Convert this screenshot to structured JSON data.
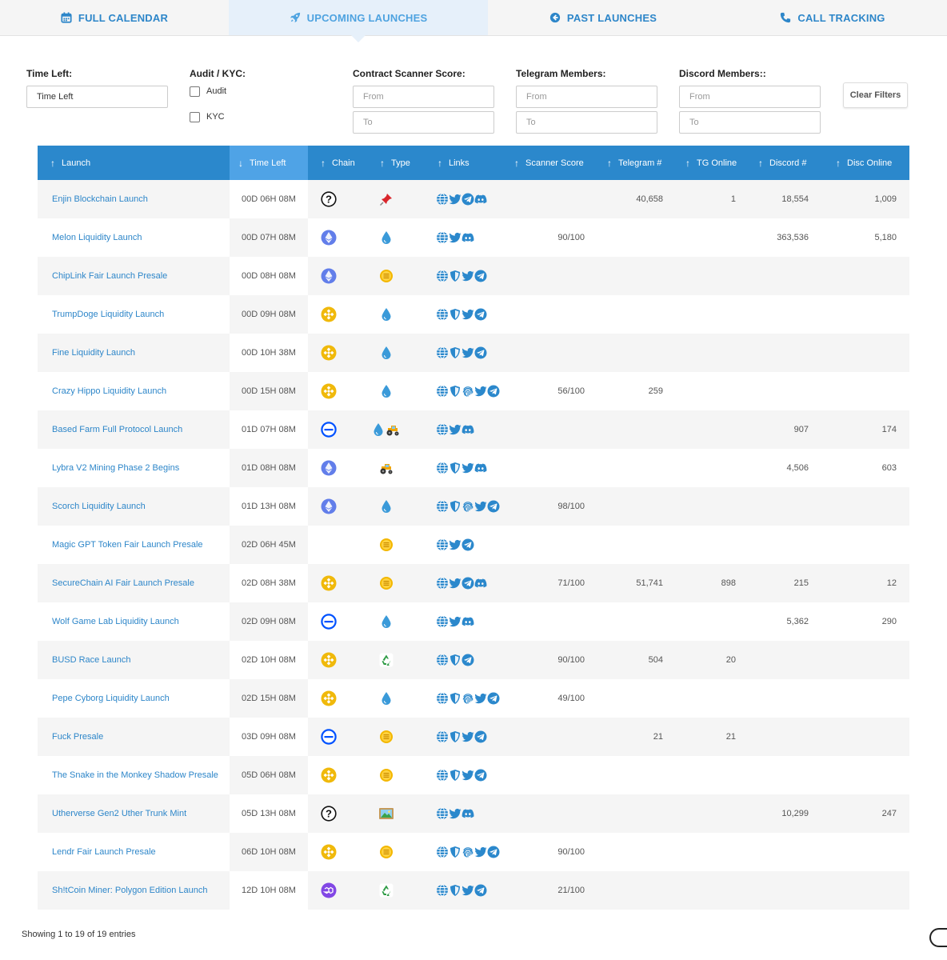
{
  "tabs": [
    {
      "label": "FULL CALENDAR",
      "icon": "calendar-icon"
    },
    {
      "label": "UPCOMING LAUNCHES",
      "icon": "rocket-icon",
      "active": true
    },
    {
      "label": "PAST LAUNCHES",
      "icon": "arrow-left-circle-icon"
    },
    {
      "label": "CALL TRACKING",
      "icon": "phone-icon"
    }
  ],
  "filters": {
    "time_left": {
      "label": "Time Left:",
      "value": "Time Left"
    },
    "audit_kyc": {
      "label": "Audit / KYC:",
      "audit": "Audit",
      "kyc": "KYC"
    },
    "scanner": {
      "label": "Contract Scanner Score:",
      "from": "From",
      "to": "To"
    },
    "telegram": {
      "label": "Telegram Members:",
      "from": "From",
      "to": "To"
    },
    "discord": {
      "label": "Discord Members::",
      "from": "From",
      "to": "To"
    },
    "clear": "Clear Filters"
  },
  "columns": [
    "Launch",
    "Time Left",
    "Chain",
    "Type",
    "Links",
    "Scanner Score",
    "Telegram #",
    "TG Online",
    "Discord #",
    "Disc Online"
  ],
  "rows": [
    {
      "launch": "Enjin Blockchain Launch",
      "time": "00D 06H 08M",
      "chain": "unknown",
      "type": [
        "pin"
      ],
      "links": [
        "web",
        "twitter",
        "telegram",
        "discord"
      ],
      "score": "",
      "tg": "40,658",
      "tgo": "1",
      "dc": "18,554",
      "dco": "1,009"
    },
    {
      "launch": "Melon Liquidity Launch",
      "time": "00D 07H 08M",
      "chain": "eth",
      "type": [
        "drop"
      ],
      "links": [
        "web",
        "twitter",
        "discord"
      ],
      "score": "90/100",
      "tg": "",
      "tgo": "",
      "dc": "363,536",
      "dco": "5,180"
    },
    {
      "launch": "ChipLink Fair Launch Presale",
      "time": "00D 08H 08M",
      "chain": "eth",
      "type": [
        "coin"
      ],
      "links": [
        "web",
        "shield",
        "twitter",
        "telegram"
      ],
      "score": "",
      "tg": "",
      "tgo": "",
      "dc": "",
      "dco": ""
    },
    {
      "launch": "TrumpDoge Liquidity Launch",
      "time": "00D 09H 08M",
      "chain": "bsc",
      "type": [
        "drop"
      ],
      "links": [
        "web",
        "shield",
        "twitter",
        "telegram"
      ],
      "score": "",
      "tg": "",
      "tgo": "",
      "dc": "",
      "dco": ""
    },
    {
      "launch": "Fine Liquidity Launch",
      "time": "00D 10H 38M",
      "chain": "bsc",
      "type": [
        "drop"
      ],
      "links": [
        "web",
        "shield",
        "twitter",
        "telegram"
      ],
      "score": "",
      "tg": "",
      "tgo": "",
      "dc": "",
      "dco": ""
    },
    {
      "launch": "Crazy Hippo Liquidity Launch",
      "time": "00D 15H 08M",
      "chain": "bsc",
      "type": [
        "drop"
      ],
      "links": [
        "web",
        "shield",
        "fingerprint",
        "twitter",
        "telegram"
      ],
      "score": "56/100",
      "tg": "259",
      "tgo": "",
      "dc": "",
      "dco": ""
    },
    {
      "launch": "Based Farm Full Protocol Launch",
      "time": "01D 07H 08M",
      "chain": "base",
      "type": [
        "drop",
        "tractor"
      ],
      "links": [
        "web",
        "twitter",
        "discord"
      ],
      "score": "",
      "tg": "",
      "tgo": "",
      "dc": "907",
      "dco": "174"
    },
    {
      "launch": "Lybra V2 Mining Phase 2 Begins",
      "time": "01D 08H 08M",
      "chain": "eth",
      "type": [
        "tractor"
      ],
      "links": [
        "web",
        "shield",
        "twitter",
        "discord"
      ],
      "score": "",
      "tg": "",
      "tgo": "",
      "dc": "4,506",
      "dco": "603"
    },
    {
      "launch": "Scorch Liquidity Launch",
      "time": "01D 13H 08M",
      "chain": "eth",
      "type": [
        "drop"
      ],
      "links": [
        "web",
        "shield",
        "fingerprint",
        "twitter",
        "telegram"
      ],
      "score": "98/100",
      "tg": "",
      "tgo": "",
      "dc": "",
      "dco": ""
    },
    {
      "launch": "Magic GPT Token Fair Launch Presale",
      "time": "02D 06H 45M",
      "chain": "none",
      "type": [
        "coin"
      ],
      "links": [
        "web",
        "twitter",
        "telegram"
      ],
      "score": "",
      "tg": "",
      "tgo": "",
      "dc": "",
      "dco": ""
    },
    {
      "launch": "SecureChain AI Fair Launch Presale",
      "time": "02D 08H 38M",
      "chain": "bsc",
      "type": [
        "coin"
      ],
      "links": [
        "web",
        "twitter",
        "telegram",
        "discord"
      ],
      "score": "71/100",
      "tg": "51,741",
      "tgo": "898",
      "dc": "215",
      "dco": "12"
    },
    {
      "launch": "Wolf Game Lab Liquidity Launch",
      "time": "02D 09H 08M",
      "chain": "base",
      "type": [
        "drop"
      ],
      "links": [
        "web",
        "twitter",
        "discord"
      ],
      "score": "",
      "tg": "",
      "tgo": "",
      "dc": "5,362",
      "dco": "290"
    },
    {
      "launch": "BUSD Race Launch",
      "time": "02D 10H 08M",
      "chain": "bsc",
      "type": [
        "recycle"
      ],
      "links": [
        "web",
        "shield",
        "telegram"
      ],
      "score": "90/100",
      "tg": "504",
      "tgo": "20",
      "dc": "",
      "dco": ""
    },
    {
      "launch": "Pepe Cyborg Liquidity Launch",
      "time": "02D 15H 08M",
      "chain": "bsc",
      "type": [
        "drop"
      ],
      "links": [
        "web",
        "shield",
        "fingerprint",
        "twitter",
        "telegram"
      ],
      "score": "49/100",
      "tg": "",
      "tgo": "",
      "dc": "",
      "dco": ""
    },
    {
      "launch": "Fuck Presale",
      "time": "03D 09H 08M",
      "chain": "base",
      "type": [
        "coin"
      ],
      "links": [
        "web",
        "shield",
        "twitter",
        "telegram"
      ],
      "score": "",
      "tg": "21",
      "tgo": "21",
      "dc": "",
      "dco": ""
    },
    {
      "launch": "The Snake in the Monkey Shadow Presale",
      "time": "05D 06H 08M",
      "chain": "bsc",
      "type": [
        "coin"
      ],
      "links": [
        "web",
        "shield",
        "twitter",
        "telegram"
      ],
      "score": "",
      "tg": "",
      "tgo": "",
      "dc": "",
      "dco": ""
    },
    {
      "launch": "Utherverse Gen2 Uther Trunk Mint",
      "time": "05D 13H 08M",
      "chain": "unknown",
      "type": [
        "picture"
      ],
      "links": [
        "web",
        "twitter",
        "discord"
      ],
      "score": "",
      "tg": "",
      "tgo": "",
      "dc": "10,299",
      "dco": "247"
    },
    {
      "launch": "Lendr Fair Launch Presale",
      "time": "06D 10H 08M",
      "chain": "bsc",
      "type": [
        "coin"
      ],
      "links": [
        "web",
        "shield",
        "fingerprint",
        "twitter",
        "telegram"
      ],
      "score": "90/100",
      "tg": "",
      "tgo": "",
      "dc": "",
      "dco": ""
    },
    {
      "launch": "Sh!tCoin Miner: Polygon Edition Launch",
      "time": "12D 10H 08M",
      "chain": "polygon",
      "type": [
        "recycle"
      ],
      "links": [
        "web",
        "shield",
        "twitter",
        "telegram"
      ],
      "score": "21/100",
      "tg": "",
      "tgo": "",
      "dc": "",
      "dco": ""
    }
  ],
  "footer": "Showing 1 to 19 of 19 entries",
  "colors": {
    "accent": "#2b88cc",
    "link": "#2d86c9",
    "sorted_header": "#4fa3e6"
  }
}
